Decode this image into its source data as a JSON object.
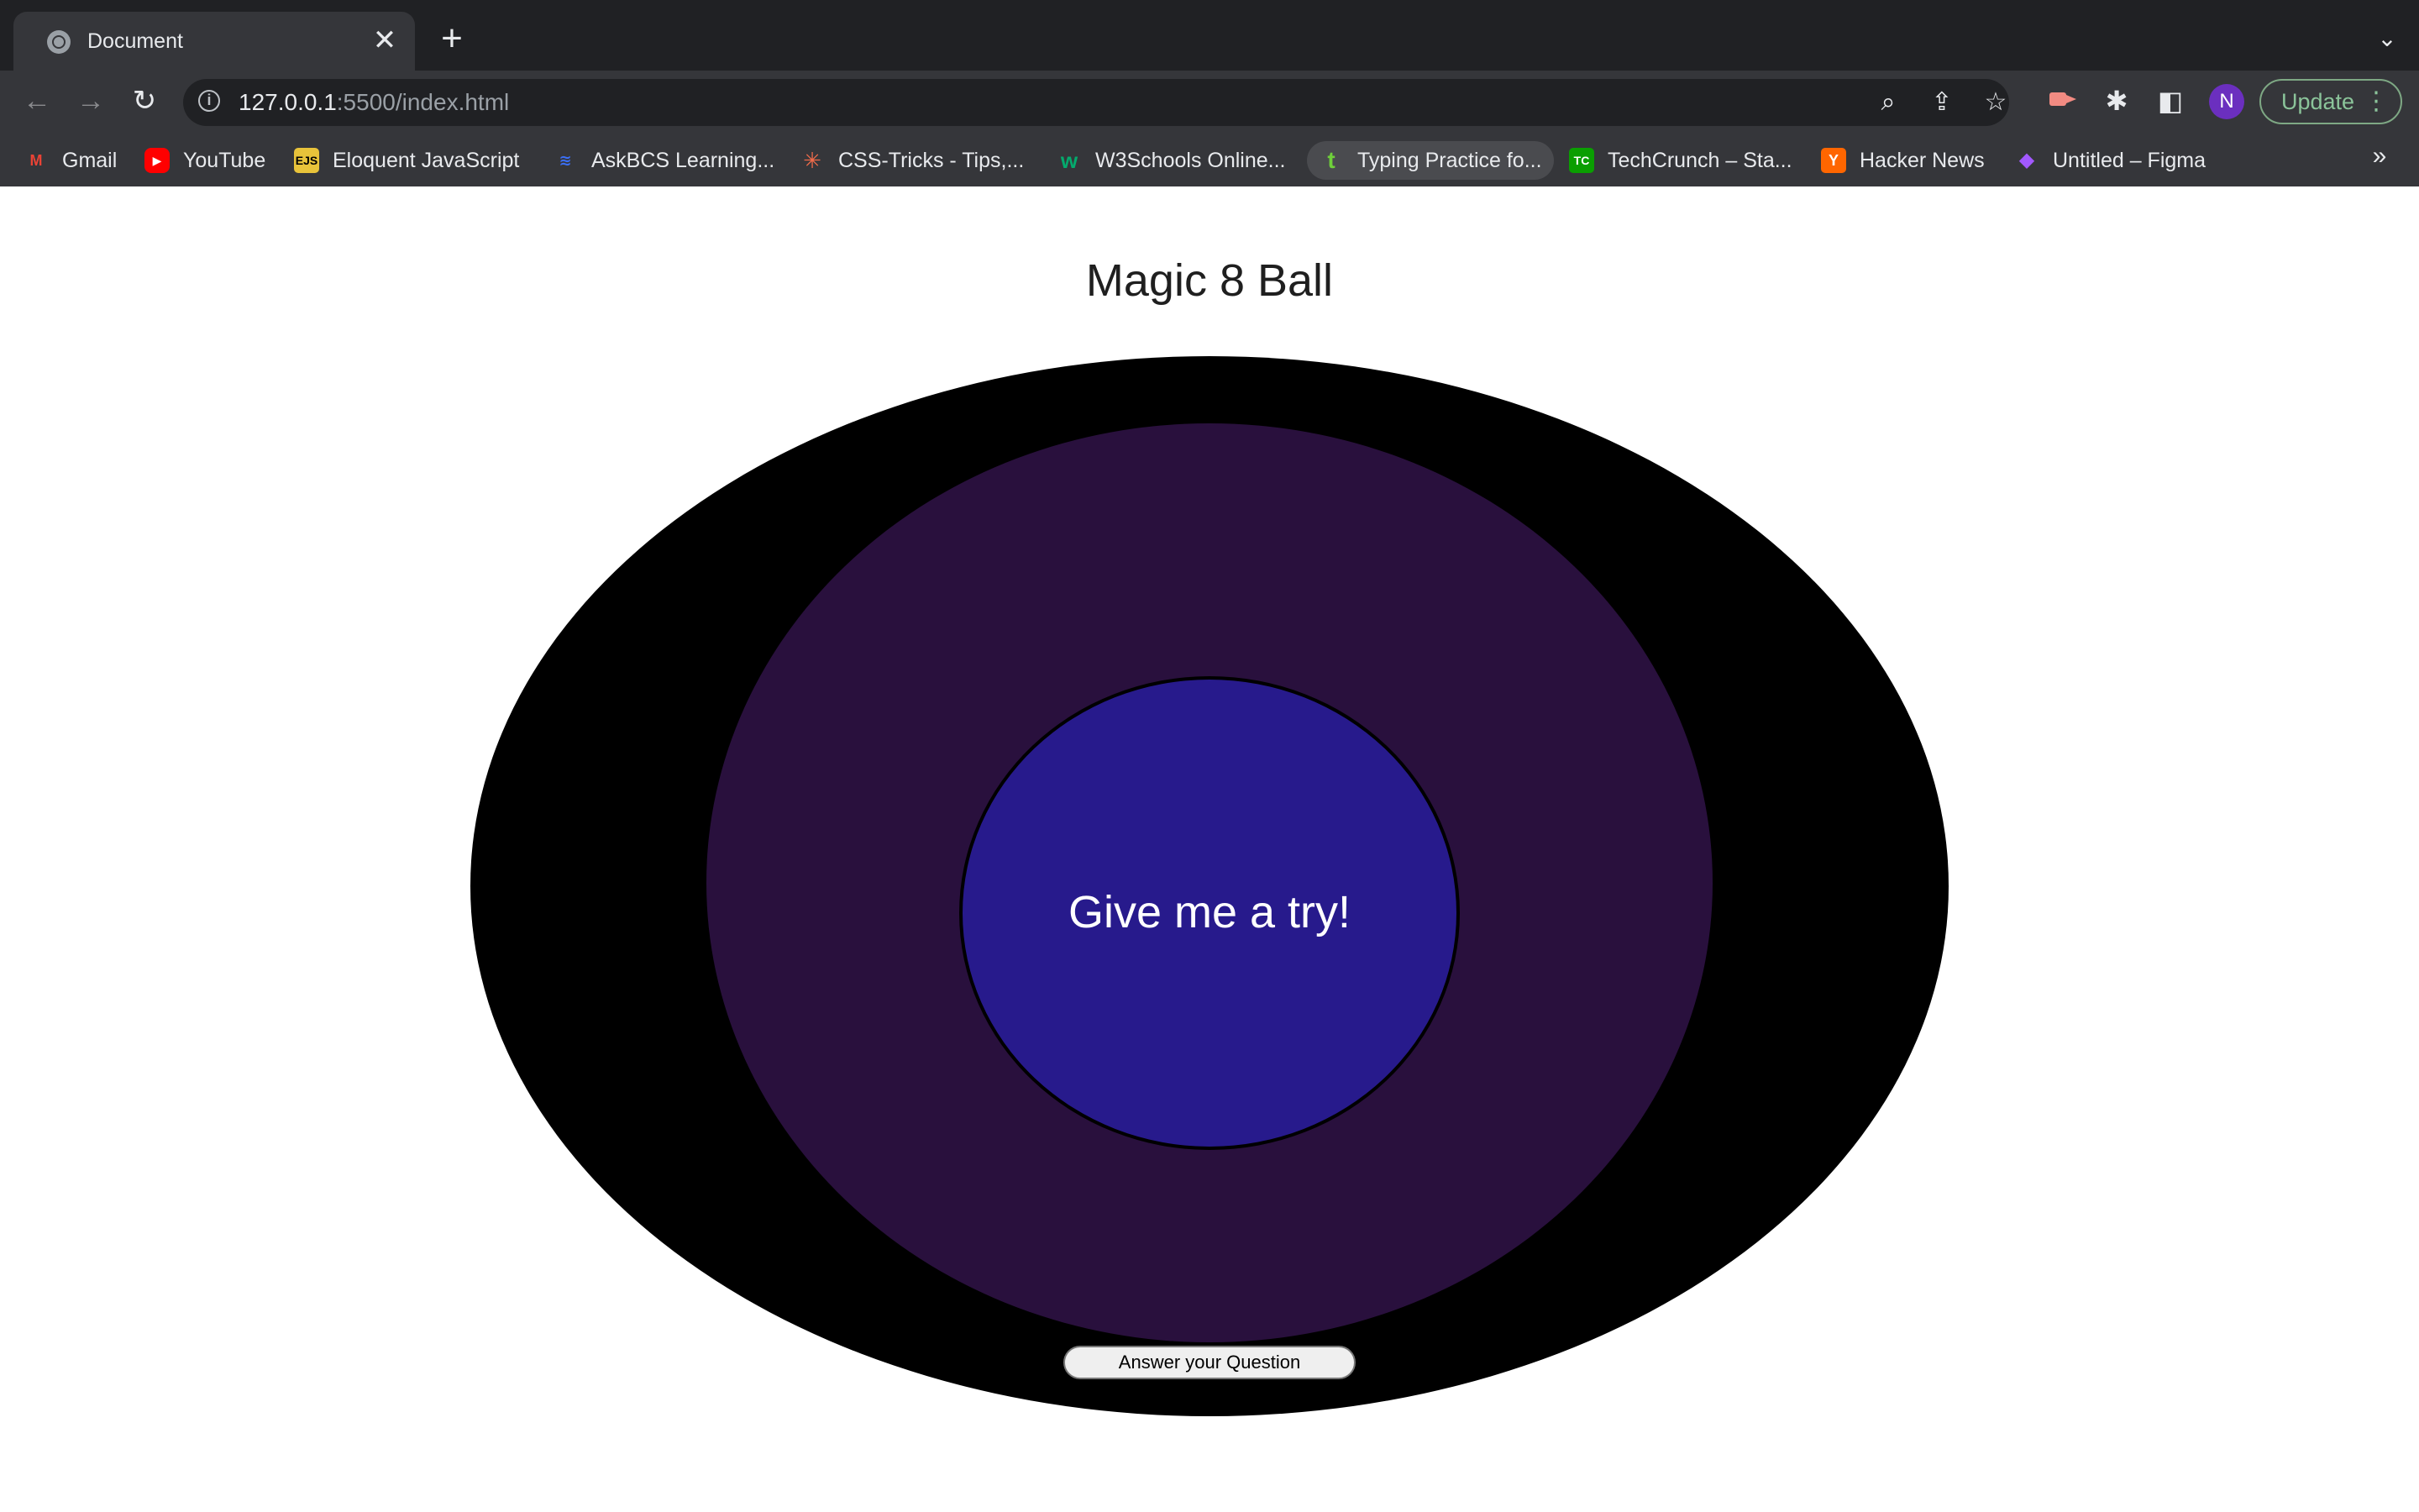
{
  "browser": {
    "tab": {
      "title": "Document",
      "close_glyph": "✕"
    },
    "new_tab_glyph": "+",
    "tab_search_glyph": "⌄",
    "nav": {
      "back_glyph": "←",
      "forward_glyph": "→",
      "reload_glyph": "↻"
    },
    "address_bar": {
      "host": "127.0.0.1",
      "rest": ":5500/index.html",
      "info_glyph": "i"
    },
    "omnibox_icons": {
      "zoom_glyph": "⌕",
      "share_glyph": "⇪",
      "star_glyph": "☆"
    },
    "extensions": {
      "puzzle_glyph": "✱",
      "sidepanel_glyph": "◧"
    },
    "profile_initial": "N",
    "update_label": "Update",
    "menu_glyph": "⋮",
    "bookmarks": [
      {
        "label": "Gmail",
        "icon": "gmail-icon",
        "glyph": "M",
        "color": "#ea4335"
      },
      {
        "label": "YouTube",
        "icon": "youtube-icon",
        "glyph": "▶",
        "color": "#ff0000"
      },
      {
        "label": "Eloquent JavaScript",
        "icon": "eloquent-js-icon",
        "glyph": "EJS",
        "color": "#e8c33a"
      },
      {
        "label": "AskBCS Learning...",
        "icon": "askbcs-icon",
        "glyph": "≋",
        "color": "#3b6ff5"
      },
      {
        "label": "CSS-Tricks - Tips,...",
        "icon": "css-tricks-icon",
        "glyph": "✳",
        "color": "#ef6b4a"
      },
      {
        "label": "W3Schools Online...",
        "icon": "w3schools-icon",
        "glyph": "w",
        "color": "#04aa6d"
      },
      {
        "label": "Typing Practice fo...",
        "icon": "typing-icon",
        "glyph": "t",
        "color": "#6fcf3b"
      },
      {
        "label": "TechCrunch – Sta...",
        "icon": "techcrunch-icon",
        "glyph": "TC",
        "color": "#0a9e01"
      },
      {
        "label": "Hacker News",
        "icon": "hacker-news-icon",
        "glyph": "Y",
        "color": "#ff6600"
      },
      {
        "label": "Untitled – Figma",
        "icon": "figma-icon",
        "glyph": "◆",
        "color": "#a259ff"
      }
    ],
    "bookmarks_more_glyph": "»"
  },
  "page": {
    "title": "Magic 8 Ball",
    "answer_text": "Give me a try!",
    "button_label": "Answer your Question"
  },
  "colors": {
    "outer_ball": "#000000",
    "middle_ball": "#29103d",
    "inner_ball": "#271a8c"
  }
}
